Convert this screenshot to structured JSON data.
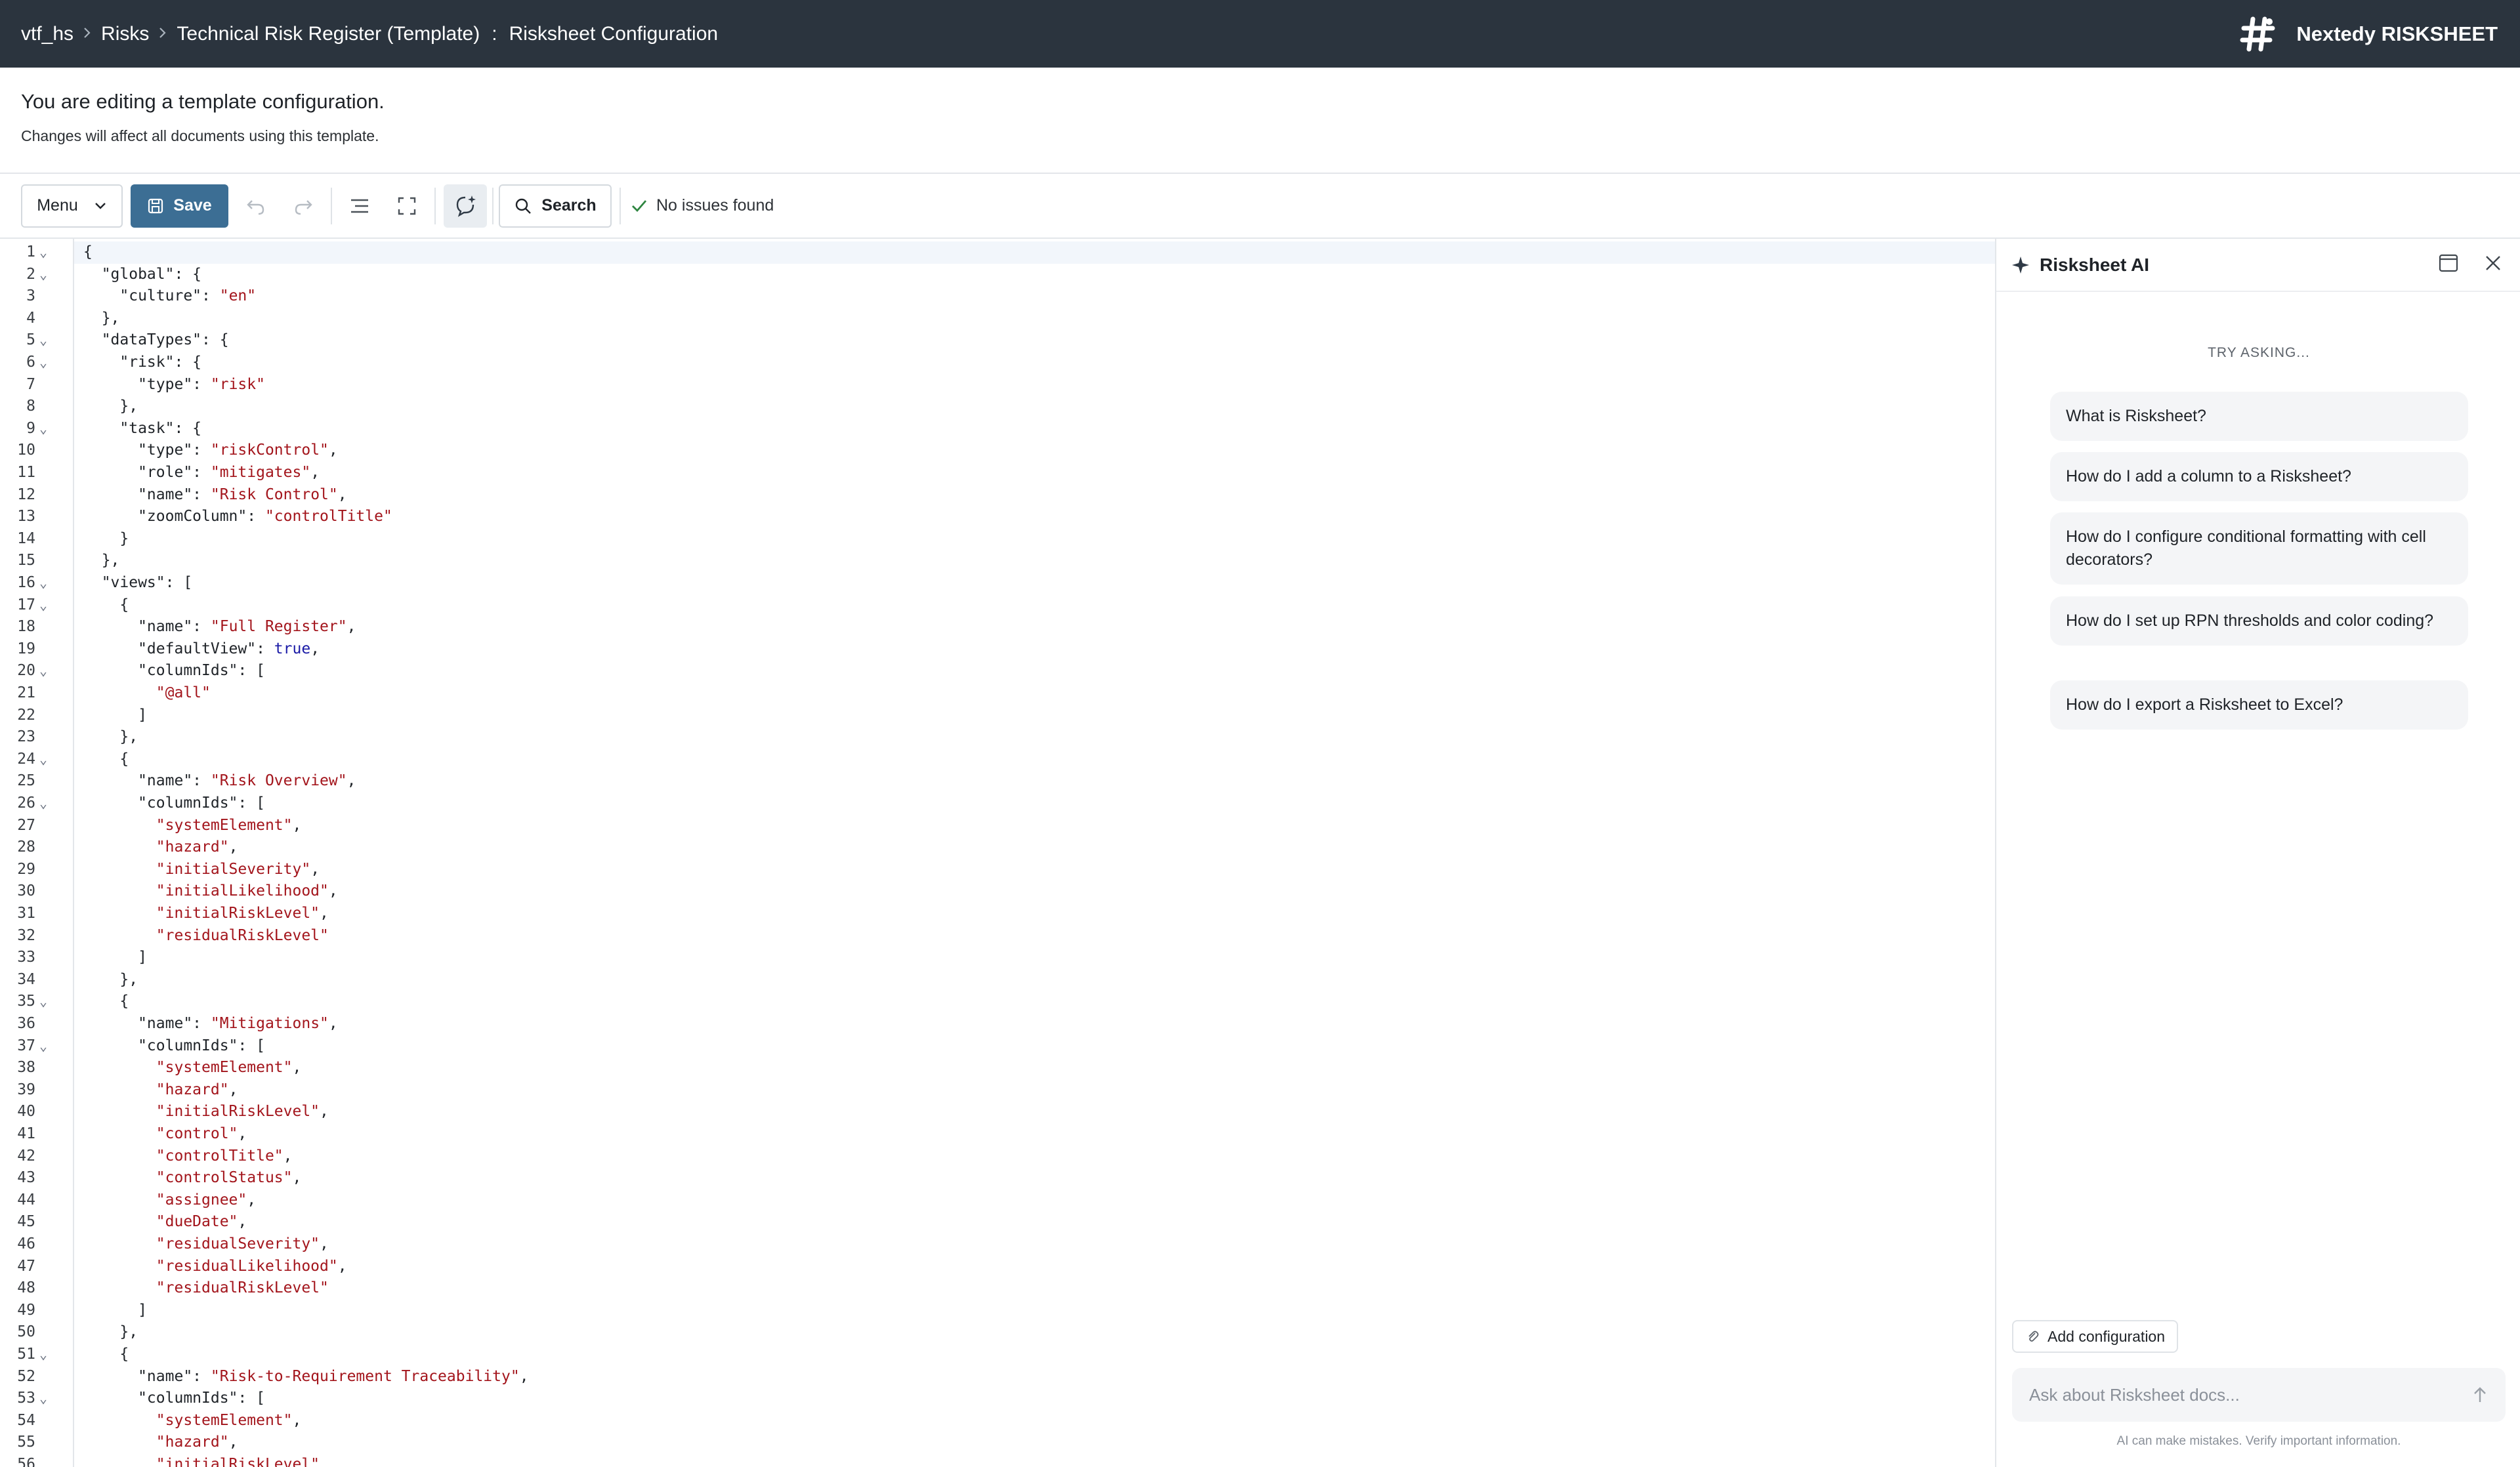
{
  "topbar": {
    "breadcrumbs": [
      "vtf_hs",
      "Risks",
      "Technical Risk Register (Template)"
    ],
    "page_title": "Risksheet Configuration",
    "brand": "Nextedy RISKSHEET"
  },
  "notice": {
    "title": "You are editing a template configuration.",
    "subtitle": "Changes will affect all documents using this template."
  },
  "toolbar": {
    "menu_label": "Menu",
    "save_label": "Save",
    "search_label": "Search",
    "status": "No issues found"
  },
  "editor": {
    "lines": [
      [
        {
          "t": "{"
        }
      ],
      [
        {
          "t": "  \"global\": {"
        }
      ],
      [
        {
          "t": "    \"culture\": "
        },
        {
          "t": "\"en\"",
          "c": "s"
        }
      ],
      [
        {
          "t": "  },"
        }
      ],
      [
        {
          "t": "  \"dataTypes\": {"
        }
      ],
      [
        {
          "t": "    \"risk\": {"
        }
      ],
      [
        {
          "t": "      \"type\": "
        },
        {
          "t": "\"risk\"",
          "c": "s"
        }
      ],
      [
        {
          "t": "    },"
        }
      ],
      [
        {
          "t": "    \"task\": {"
        }
      ],
      [
        {
          "t": "      \"type\": "
        },
        {
          "t": "\"riskControl\"",
          "c": "s"
        },
        {
          "t": ","
        }
      ],
      [
        {
          "t": "      \"role\": "
        },
        {
          "t": "\"mitigates\"",
          "c": "s"
        },
        {
          "t": ","
        }
      ],
      [
        {
          "t": "      \"name\": "
        },
        {
          "t": "\"Risk Control\"",
          "c": "s"
        },
        {
          "t": ","
        }
      ],
      [
        {
          "t": "      \"zoomColumn\": "
        },
        {
          "t": "\"controlTitle\"",
          "c": "s"
        }
      ],
      [
        {
          "t": "    }"
        }
      ],
      [
        {
          "t": "  },"
        }
      ],
      [
        {
          "t": "  \"views\": ["
        }
      ],
      [
        {
          "t": "    {"
        }
      ],
      [
        {
          "t": "      \"name\": "
        },
        {
          "t": "\"Full Register\"",
          "c": "s"
        },
        {
          "t": ","
        }
      ],
      [
        {
          "t": "      \"defaultView\": "
        },
        {
          "t": "true",
          "c": "b"
        },
        {
          "t": ","
        }
      ],
      [
        {
          "t": "      \"columnIds\": ["
        }
      ],
      [
        {
          "t": "        "
        },
        {
          "t": "\"@all\"",
          "c": "s"
        }
      ],
      [
        {
          "t": "      ]"
        }
      ],
      [
        {
          "t": "    },"
        }
      ],
      [
        {
          "t": "    {"
        }
      ],
      [
        {
          "t": "      \"name\": "
        },
        {
          "t": "\"Risk Overview\"",
          "c": "s"
        },
        {
          "t": ","
        }
      ],
      [
        {
          "t": "      \"columnIds\": ["
        }
      ],
      [
        {
          "t": "        "
        },
        {
          "t": "\"systemElement\"",
          "c": "s"
        },
        {
          "t": ","
        }
      ],
      [
        {
          "t": "        "
        },
        {
          "t": "\"hazard\"",
          "c": "s"
        },
        {
          "t": ","
        }
      ],
      [
        {
          "t": "        "
        },
        {
          "t": "\"initialSeverity\"",
          "c": "s"
        },
        {
          "t": ","
        }
      ],
      [
        {
          "t": "        "
        },
        {
          "t": "\"initialLikelihood\"",
          "c": "s"
        },
        {
          "t": ","
        }
      ],
      [
        {
          "t": "        "
        },
        {
          "t": "\"initialRiskLevel\"",
          "c": "s"
        },
        {
          "t": ","
        }
      ],
      [
        {
          "t": "        "
        },
        {
          "t": "\"residualRiskLevel\"",
          "c": "s"
        }
      ],
      [
        {
          "t": "      ]"
        }
      ],
      [
        {
          "t": "    },"
        }
      ],
      [
        {
          "t": "    {"
        }
      ],
      [
        {
          "t": "      \"name\": "
        },
        {
          "t": "\"Mitigations\"",
          "c": "s"
        },
        {
          "t": ","
        }
      ],
      [
        {
          "t": "      \"columnIds\": ["
        }
      ],
      [
        {
          "t": "        "
        },
        {
          "t": "\"systemElement\"",
          "c": "s"
        },
        {
          "t": ","
        }
      ],
      [
        {
          "t": "        "
        },
        {
          "t": "\"hazard\"",
          "c": "s"
        },
        {
          "t": ","
        }
      ],
      [
        {
          "t": "        "
        },
        {
          "t": "\"initialRiskLevel\"",
          "c": "s"
        },
        {
          "t": ","
        }
      ],
      [
        {
          "t": "        "
        },
        {
          "t": "\"control\"",
          "c": "s"
        },
        {
          "t": ","
        }
      ],
      [
        {
          "t": "        "
        },
        {
          "t": "\"controlTitle\"",
          "c": "s"
        },
        {
          "t": ","
        }
      ],
      [
        {
          "t": "        "
        },
        {
          "t": "\"controlStatus\"",
          "c": "s"
        },
        {
          "t": ","
        }
      ],
      [
        {
          "t": "        "
        },
        {
          "t": "\"assignee\"",
          "c": "s"
        },
        {
          "t": ","
        }
      ],
      [
        {
          "t": "        "
        },
        {
          "t": "\"dueDate\"",
          "c": "s"
        },
        {
          "t": ","
        }
      ],
      [
        {
          "t": "        "
        },
        {
          "t": "\"residualSeverity\"",
          "c": "s"
        },
        {
          "t": ","
        }
      ],
      [
        {
          "t": "        "
        },
        {
          "t": "\"residualLikelihood\"",
          "c": "s"
        },
        {
          "t": ","
        }
      ],
      [
        {
          "t": "        "
        },
        {
          "t": "\"residualRiskLevel\"",
          "c": "s"
        }
      ],
      [
        {
          "t": "      ]"
        }
      ],
      [
        {
          "t": "    },"
        }
      ],
      [
        {
          "t": "    {"
        }
      ],
      [
        {
          "t": "      \"name\": "
        },
        {
          "t": "\"Risk-to-Requirement Traceability\"",
          "c": "s"
        },
        {
          "t": ","
        }
      ],
      [
        {
          "t": "      \"columnIds\": ["
        }
      ],
      [
        {
          "t": "        "
        },
        {
          "t": "\"systemElement\"",
          "c": "s"
        },
        {
          "t": ","
        }
      ],
      [
        {
          "t": "        "
        },
        {
          "t": "\"hazard\"",
          "c": "s"
        },
        {
          "t": ","
        }
      ],
      [
        {
          "t": "        "
        },
        {
          "t": "\"initialRiskLevel\"",
          "c": "s"
        }
      ]
    ],
    "fold_lines": [
      1,
      2,
      5,
      6,
      9,
      16,
      17,
      20,
      24,
      26,
      35,
      37,
      51,
      53
    ]
  },
  "ai_panel": {
    "title": "Risksheet AI",
    "try_asking": "TRY ASKING...",
    "suggestions": [
      "What is Risksheet?",
      "How do I add a column to a Risksheet?",
      "How do I configure conditional formatting with cell decorators?",
      "How do I set up RPN thresholds and color coding?",
      "How do I export a Risksheet to Excel?"
    ],
    "add_config_label": "Add configuration",
    "input_placeholder": "Ask about Risksheet docs...",
    "disclaimer": "AI can make mistakes. Verify important information."
  },
  "icons": {
    "brand": "hash-logo-icon",
    "save": "floppy-disk-icon",
    "undo": "undo-icon",
    "redo": "redo-icon",
    "format": "align-lines-icon",
    "fullscreen": "expand-icon",
    "assistant": "chat-sparkle-icon",
    "search": "search-icon",
    "status": "check-icon",
    "ai": "sparkle-icon",
    "close": "close-icon",
    "attach": "paperclip-icon",
    "send": "arrow-up-icon"
  },
  "colors": {
    "topbar_bg": "#2b343e",
    "save_bg": "#3c6e94",
    "string": "#a3151c",
    "boolean": "#1a1aa6",
    "status_check": "#2e8540"
  }
}
